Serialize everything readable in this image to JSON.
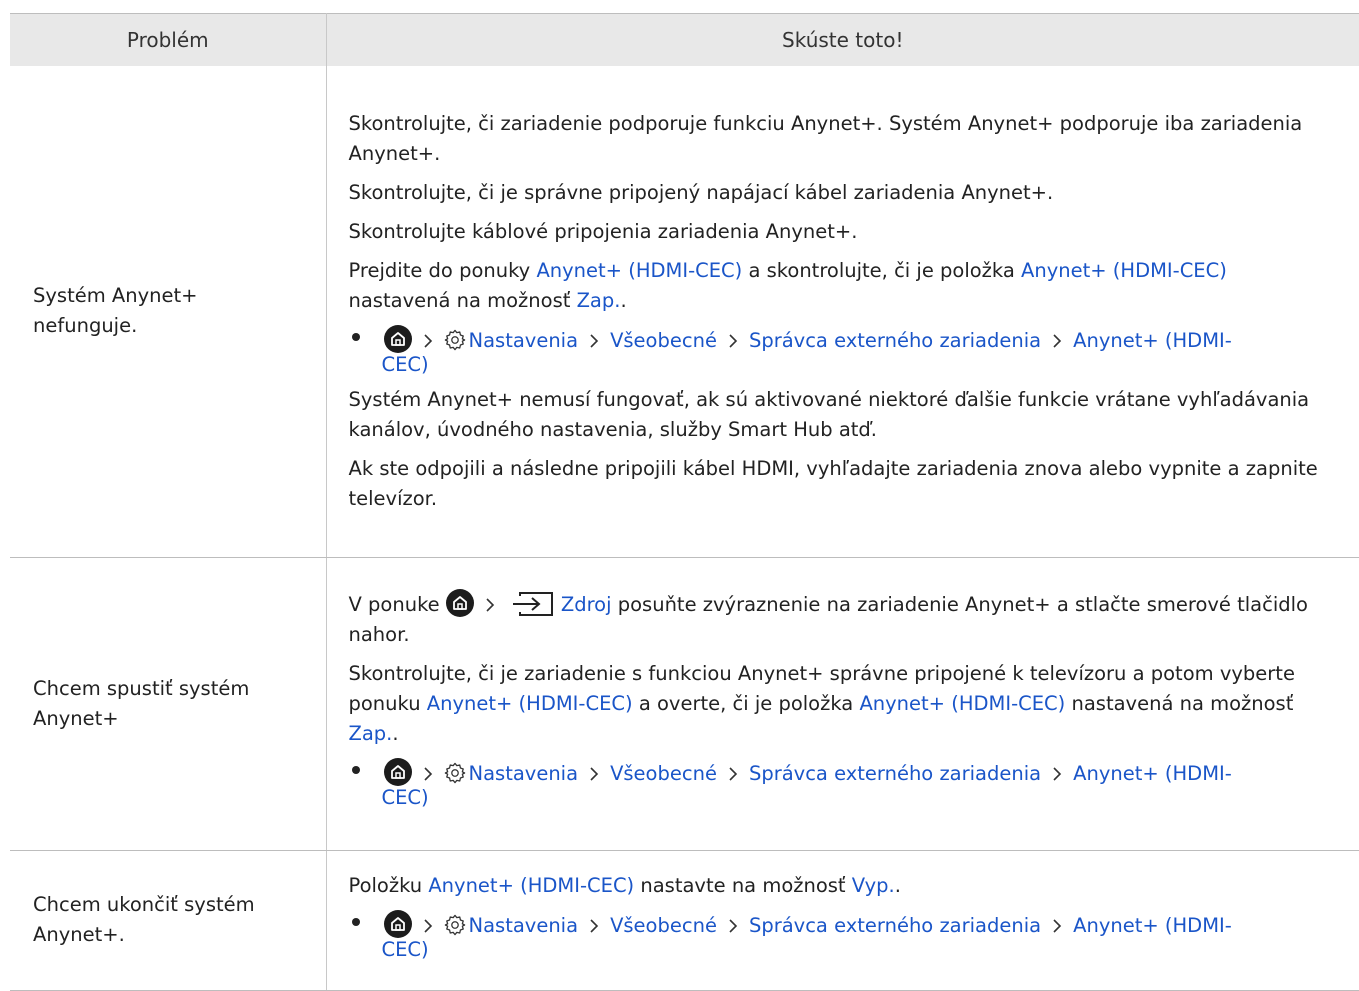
{
  "header": {
    "col1": "Problém",
    "col2": "Skúste toto!"
  },
  "breadcrumb": {
    "settings": "Nastavenia",
    "general": "Všeobecné",
    "manager": "Správca externého zariadenia",
    "anynet_a": "Anynet+ (HDMI-",
    "anynet_b": "CEC)"
  },
  "rows": [
    {
      "problem_line1": "Systém Anynet+",
      "problem_line2": "nefunguje.",
      "p1": "Skontrolujte, či zariadenie podporuje funkciu Anynet+. Systém Anynet+ podporuje iba zariadenia Anynet+.",
      "p2": "Skontrolujte, či je správne pripojený napájací kábel zariadenia Anynet+.",
      "p3": "Skontrolujte káblové pripojenia zariadenia Anynet+.",
      "p4_t1": "Prejdite do ponuky ",
      "p4_l1": "Anynet+ (HDMI-CEC)",
      "p4_t2": " a skontrolujte, či je položka ",
      "p4_l2": "Anynet+ (HDMI-CEC)",
      "p4_t3": " nastavená na možnosť ",
      "p4_l3": "Zap.",
      "p4_t4": ".",
      "p5": "Systém Anynet+ nemusí fungovať, ak sú aktivované niektoré ďalšie funkcie vrátane vyhľadávania kanálov, úvodného nastavenia, služby Smart Hub atď.",
      "p6": "Ak ste odpojili a následne pripojili kábel HDMI, vyhľadajte zariadenia znova alebo vypnite a zapnite televízor."
    },
    {
      "problem_line1": "Chcem spustiť systém",
      "problem_line2": "Anynet+",
      "p1_t1": "V ponuke ",
      "p1_l1": "Zdroj",
      "p1_t2": " posuňte zvýraznenie na zariadenie Anynet+ a stlačte smerové tlačidlo nahor.",
      "p2_t1": "Skontrolujte, či je zariadenie s funkciou Anynet+ správne pripojené k televízoru a potom vyberte ponuku ",
      "p2_l1": "Anynet+ (HDMI-CEC)",
      "p2_t2": " a overte, či je položka ",
      "p2_l2": "Anynet+ (HDMI-CEC)",
      "p2_t3": " nastavená na možnosť ",
      "p2_l3": "Zap.",
      "p2_t4": "."
    },
    {
      "problem_line1": "Chcem ukončiť systém",
      "problem_line2": "Anynet+.",
      "p1_t1": "Položku ",
      "p1_l1": "Anynet+ (HDMI-CEC)",
      "p1_t2": " nastavte na možnosť ",
      "p1_l2": "Vyp.",
      "p1_t3": "."
    }
  ],
  "icons": [
    "home-icon",
    "chevron-right-icon",
    "gear-icon",
    "source-input-icon",
    "bullet-icon"
  ],
  "colors": {
    "link": "#1a55c8",
    "header_bg": "#e8e8e8",
    "border": "#bdbdbd",
    "text": "#222222"
  }
}
